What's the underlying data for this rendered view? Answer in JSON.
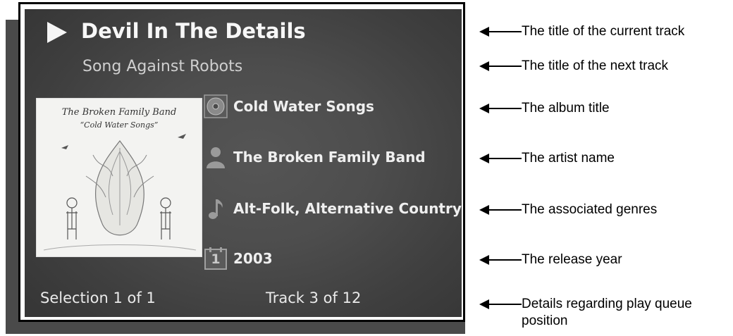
{
  "player": {
    "current_track": "Devil In The Details",
    "next_track": "Song Against Robots",
    "album_art": {
      "band_text": "The Broken Family Band",
      "album_text": "“Cold Water Songs”"
    },
    "info": {
      "album": "Cold Water Songs",
      "artist": "The Broken Family Band",
      "genres": "Alt-Folk, Alternative Country",
      "year": "2003",
      "calendar_icon_digit": "1"
    },
    "footer": {
      "selection": "Selection 1 of 1",
      "track_position": "Track 3 of 12"
    }
  },
  "callouts": [
    "The title of the current track",
    "The title of the next track",
    "The album title",
    "The artist name",
    "The associated genres",
    "The release year",
    "Details regarding play queue position"
  ],
  "icons": {
    "play": "play-icon",
    "album": "disc-icon",
    "artist": "person-icon",
    "genre": "music-note-icon",
    "year": "calendar-icon"
  }
}
